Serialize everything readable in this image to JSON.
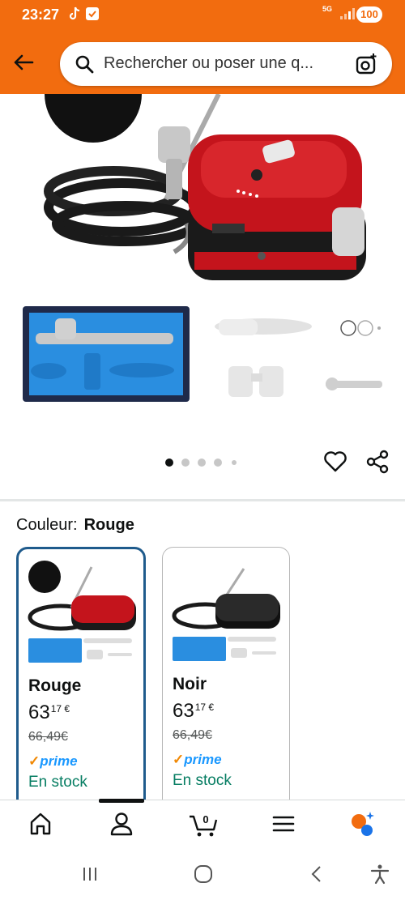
{
  "status_bar": {
    "time": "23:27",
    "network": "5G",
    "battery": "100"
  },
  "header": {
    "search_placeholder": "Rechercher ou poser une q..."
  },
  "gallery": {
    "dot_count": 5,
    "active_dot": 0
  },
  "variant": {
    "label": "Couleur:",
    "selected": "Rouge"
  },
  "cards": [
    {
      "name": "Rouge",
      "price_whole": "63",
      "price_cents": "17 €",
      "old_price": "66,49€",
      "prime": "prime",
      "stock": "En stock",
      "body_color": "#c4141c"
    },
    {
      "name": "Noir",
      "price_whole": "63",
      "price_cents": "17 €",
      "old_price": "66,49€",
      "prime": "prime",
      "stock": "En stock",
      "body_color": "#222222"
    }
  ],
  "colors": {
    "header": "#f26c0f",
    "selected_border": "#1f5b8c",
    "stock": "#067d62",
    "prime": "#1a98ff"
  },
  "bottom_nav": [
    "home-icon",
    "account-icon",
    "cart-icon",
    "menu-icon",
    "ai-assistant-icon"
  ],
  "cart_count": "0"
}
